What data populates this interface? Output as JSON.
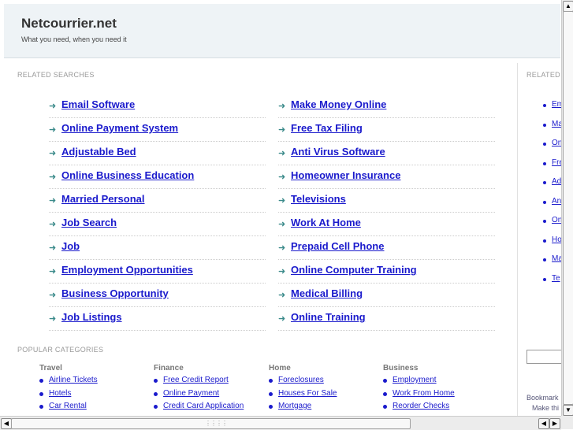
{
  "header": {
    "title": "Netcourrier.net",
    "tagline": "What you need, when you need it"
  },
  "related_searches": {
    "label": "RELATED SEARCHES",
    "left": [
      "Email Software",
      "Online Payment System",
      "Adjustable Bed",
      "Online Business Education",
      "Married Personal",
      "Job Search",
      "Job",
      "Employment Opportunities",
      "Business Opportunity",
      "Job Listings"
    ],
    "right": [
      "Make Money Online",
      "Free Tax Filing",
      "Anti Virus Software",
      "Homeowner Insurance",
      "Televisions",
      "Work At Home",
      "Prepaid Cell Phone",
      "Online Computer Training",
      "Medical Billing",
      "Online Training"
    ]
  },
  "popular_categories": {
    "label": "POPULAR CATEGORIES",
    "columns": [
      {
        "heading": "Travel",
        "items": [
          "Airline Tickets",
          "Hotels",
          "Car Rental"
        ]
      },
      {
        "heading": "Finance",
        "items": [
          "Free Credit Report",
          "Online Payment",
          "Credit Card Application"
        ]
      },
      {
        "heading": "Home",
        "items": [
          "Foreclosures",
          "Houses For Sale",
          "Mortgage"
        ]
      },
      {
        "heading": "Business",
        "items": [
          "Employment",
          "Work From Home",
          "Reorder Checks"
        ]
      }
    ]
  },
  "sidebar": {
    "label": "RELATED",
    "items": [
      "Em",
      "Ma",
      "On",
      "Fre",
      "Ad",
      "Ant",
      "On",
      "Ho",
      "Ma",
      "Te"
    ],
    "bookmark": "Bookmark",
    "make_this": "Make thi"
  }
}
